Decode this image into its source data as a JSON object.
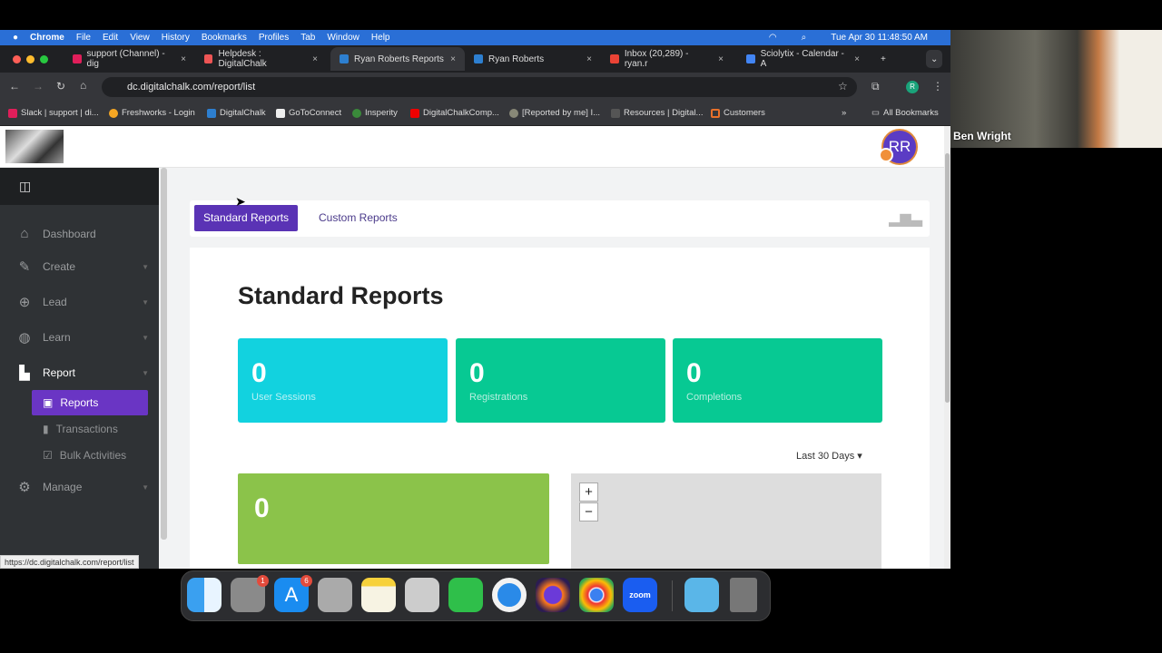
{
  "menubar": {
    "apple": "",
    "app": "Chrome",
    "items": [
      "File",
      "Edit",
      "View",
      "History",
      "Bookmarks",
      "Profiles",
      "Tab",
      "Window",
      "Help"
    ],
    "datetime": "Tue Apr 30  11:48:50 AM"
  },
  "tabs": [
    {
      "title": "support (Channel) - dig",
      "color": "#e01e5a"
    },
    {
      "title": "Helpdesk : DigitalChalk",
      "color": "#e55"
    },
    {
      "title": "Ryan Roberts Reports",
      "color": "#2d7fd0",
      "active": true
    },
    {
      "title": "Ryan Roberts",
      "color": "#2d7fd0"
    },
    {
      "title": "Inbox (20,289) - ryan.r",
      "color": "#ea4335"
    },
    {
      "title": "Sciolytix - Calendar - A",
      "color": "#4285f4"
    }
  ],
  "address": {
    "url": "dc.digitalchalk.com/report/list",
    "profile": "R"
  },
  "bookmarks": [
    "Slack | support | di...",
    "Freshworks - Login",
    "DigitalChalk",
    "GoToConnect",
    "Insperity",
    "DigitalChalkComp...",
    "[Reported by me] I...",
    "Resources | Digital...",
    "Customers"
  ],
  "all_bookmarks": "All Bookmarks",
  "header": {
    "avatar_initials": "RR"
  },
  "sidebar": {
    "items": [
      {
        "label": "Dashboard",
        "icon": "home-icon"
      },
      {
        "label": "Create",
        "icon": "tools-icon"
      },
      {
        "label": "Lead",
        "icon": "compass-icon"
      },
      {
        "label": "Learn",
        "icon": "brain-icon"
      },
      {
        "label": "Report",
        "icon": "bar-chart-icon"
      },
      {
        "label": "Manage",
        "icon": "gear-icon"
      }
    ],
    "sub": [
      {
        "label": "Reports",
        "active": true
      },
      {
        "label": "Transactions"
      },
      {
        "label": "Bulk Activities"
      }
    ]
  },
  "main": {
    "tab_standard": "Standard Reports",
    "tab_custom": "Custom Reports",
    "title": "Standard Reports",
    "stats": [
      {
        "value": "0",
        "label": "User Sessions",
        "color": "#12d2df"
      },
      {
        "value": "0",
        "label": "Registrations",
        "color": "#07c993"
      },
      {
        "value": "0",
        "label": "Completions",
        "color": "#07c993"
      }
    ],
    "range": "Last 30 Days",
    "panel_value": "0",
    "zoom_in": "+",
    "zoom_out": "−"
  },
  "status_url": "https://dc.digitalchalk.com/report/list",
  "dock": {
    "badges": {
      "settings": "1",
      "appstore": "6"
    },
    "zoom_label": "zoom"
  },
  "video": {
    "name": "Ben Wright"
  }
}
